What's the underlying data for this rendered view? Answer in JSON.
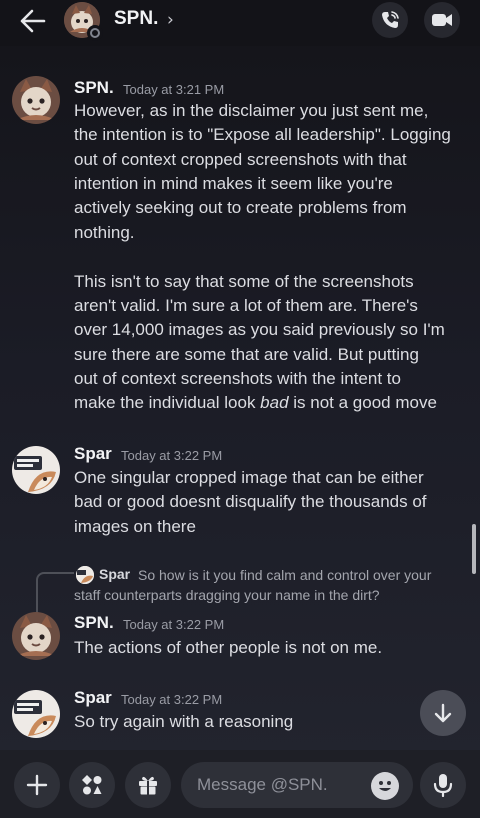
{
  "header": {
    "title": "SPN.",
    "chevron": "›",
    "icons": [
      "back-arrow-icon",
      "phone-call-icon",
      "video-camera-icon"
    ]
  },
  "messages": [
    {
      "author": "SPN.",
      "timestamp": "Today at 3:21 PM",
      "lines": [
        "However, as in the disclaimer you just sent me,",
        "the intention is to \"Expose all leadership\". Logging",
        "out of context cropped screenshots with that",
        "intention in mind makes it seem like you're",
        "actively seeking out to create problems from",
        "nothing.",
        "This isn't to say that some of the screenshots",
        "aren't valid. I'm sure a lot of them are. There's",
        "over 14,000 images as you said previously so I'm",
        "sure there are some that are valid. But putting",
        "out of context screenshots with the intent to",
        "make the individual look "
      ],
      "emphasis": "bad",
      "after_emphasis": " is not a good move"
    },
    {
      "author": "Spar",
      "timestamp": "Today at 3:22 PM",
      "lines": [
        "One singular cropped image that can be either",
        "bad or good doesnt disqualify the thousands of",
        "images on there"
      ]
    },
    {
      "reply": {
        "author": "Spar",
        "text_line1": "So how is it you find calm and control over your",
        "text_line2": "staff counterparts dragging your name in the dirt?"
      },
      "author": "SPN.",
      "timestamp": "Today at 3:22 PM",
      "lines": [
        "The actions of other people is not on me."
      ]
    },
    {
      "author": "Spar",
      "timestamp": "Today at 3:22 PM",
      "lines": [
        "So try again with a reasoning"
      ]
    }
  ],
  "composer": {
    "placeholder": "Message @SPN.",
    "icons": [
      "plus-icon",
      "apps-icon",
      "gift-icon",
      "emoji-icon",
      "microphone-icon"
    ]
  },
  "jump_icon": "arrow-down-icon",
  "colors": {
    "background": "#1b1c26",
    "header": "#131318",
    "composer": "#1e1f26",
    "button": "#2e3038",
    "text": "#dcdde2",
    "muted": "#9a9ca5"
  }
}
